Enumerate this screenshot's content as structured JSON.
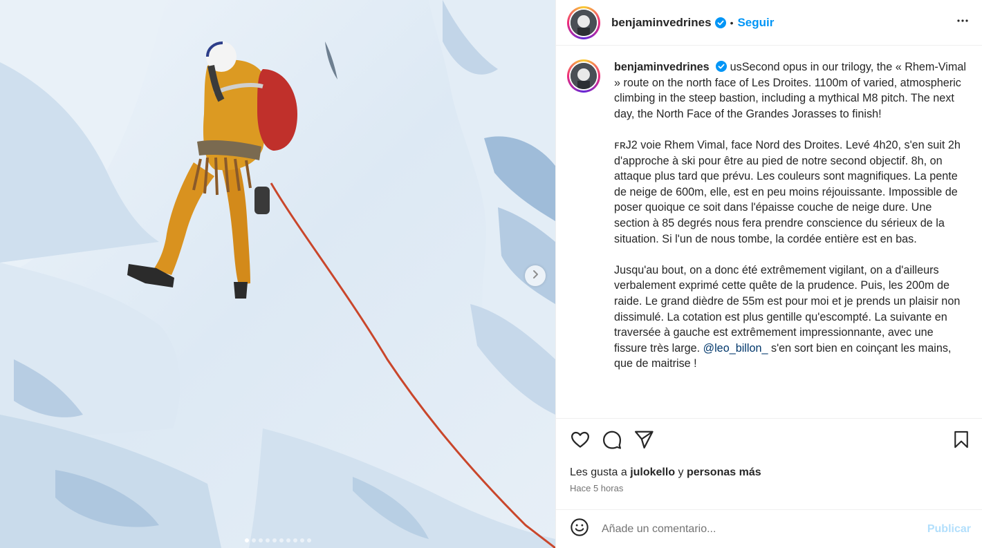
{
  "post": {
    "username": "benjaminvedrines",
    "verified": true,
    "separator": "•",
    "follow_label": "Seguir",
    "caption_lead": "usSecond opus in our trilogy, the « Rhem-Vimal » route on the north face of Les Droites. 1100m of varied, atmospheric climbing in the steep bastion, including a mythical M8 pitch. The next day, the North Face of the Grandes Jorasses to finish!",
    "caption_p2": "ꜰʀJ2 voie Rhem Vimal, face Nord des Droites. Levé 4h20, s'en suit 2h d'approche à ski pour être au pied de notre second objectif. 8h, on attaque plus tard que prévu. Les couleurs sont magnifiques. La pente de neige de 600m, elle, est en peu moins réjouissante. Impossible de poser quoique ce soit dans l'épaisse couche de neige dure. Une section à 85 degrés nous fera prendre conscience du sérieux de la situation. Si l'un de nous tombe, la cordée entière est en bas.",
    "caption_p3_before": "Jusqu'au bout, on a donc été extrêmement vigilant, on a d'ailleurs verbalement exprimé cette quête de la prudence. Puis, les 200m de raide. Le grand dièdre de 55m est pour moi et je prends un plaisir non dissimulé. La cotation est plus gentille qu'escompté. La suivante en traversée à gauche est extrêmement impressionnante, avec une fissure très large.",
    "mention": "@leo_billon_",
    "caption_p3_after": "s'en sort bien en coinçant les mains, que de maitrise !",
    "likes_prefix": "Les gusta a",
    "likes_user": "julokello",
    "likes_connector": "y",
    "likes_rest": "personas más",
    "time_ago": "Hace 5 horas",
    "comment_placeholder": "Añade un comentario...",
    "publish_label": "Publicar",
    "carousel_index": 1,
    "carousel_total": 10
  },
  "icons": {
    "more": "more-options-icon",
    "like": "heart-icon",
    "comment": "comment-icon",
    "share": "share-icon",
    "save": "bookmark-icon",
    "emoji": "emoji-icon",
    "next": "chevron-right-icon"
  },
  "colors": {
    "accent": "#0095f6",
    "publish_disabled": "#b2dffc",
    "verified": "#0095f6",
    "rope": "#c9462b",
    "jacket": "#d9921f",
    "backpack": "#c0302b"
  }
}
